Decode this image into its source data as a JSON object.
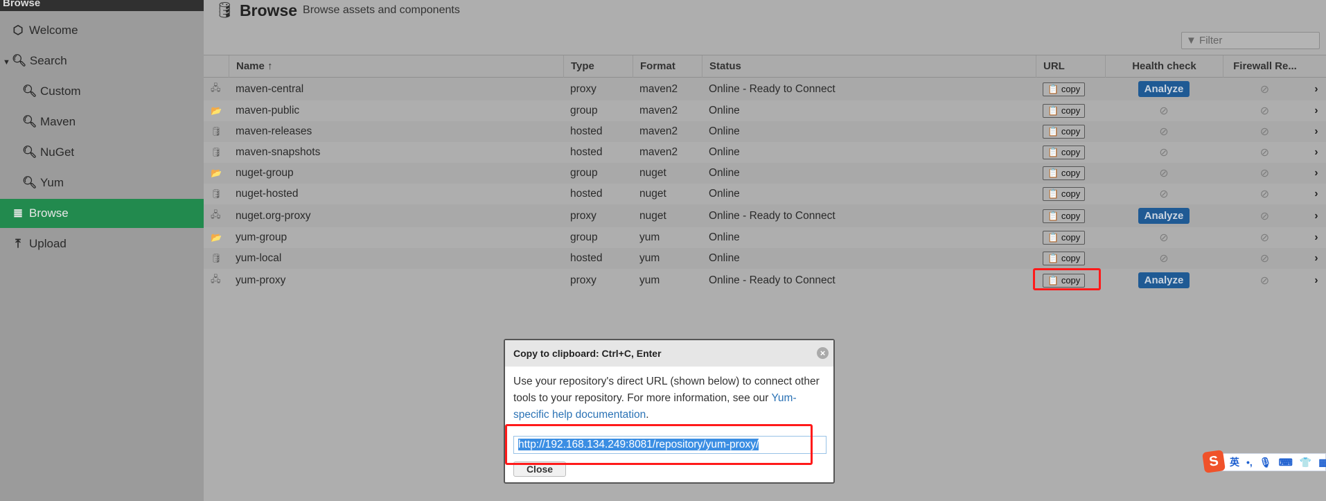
{
  "sidebar": {
    "header": "Browse",
    "items": [
      {
        "label": "Welcome",
        "icon": "hexagon-icon"
      },
      {
        "label": "Search",
        "icon": "search-icon",
        "expanded": true
      },
      {
        "label": "Custom",
        "icon": "search-icon"
      },
      {
        "label": "Maven",
        "icon": "search-icon"
      },
      {
        "label": "NuGet",
        "icon": "search-icon"
      },
      {
        "label": "Yum",
        "icon": "search-icon"
      },
      {
        "label": "Browse",
        "icon": "database-icon",
        "active": true
      },
      {
        "label": "Upload",
        "icon": "upload-icon"
      }
    ]
  },
  "header": {
    "title": "Browse",
    "subtitle": "Browse assets and components",
    "filter_placeholder": "Filter"
  },
  "table": {
    "columns": [
      "Name ↑",
      "Type",
      "Format",
      "Status",
      "URL",
      "Health check",
      "Firewall Re..."
    ],
    "copy_label": "copy",
    "analyze_label": "Analyze",
    "rows": [
      {
        "name": "maven-central",
        "type": "proxy",
        "format": "maven2",
        "status": "Online - Ready to Connect"
      },
      {
        "name": "maven-public",
        "type": "group",
        "format": "maven2",
        "status": "Online"
      },
      {
        "name": "maven-releases",
        "type": "hosted",
        "format": "maven2",
        "status": "Online"
      },
      {
        "name": "maven-snapshots",
        "type": "hosted",
        "format": "maven2",
        "status": "Online"
      },
      {
        "name": "nuget-group",
        "type": "group",
        "format": "nuget",
        "status": "Online"
      },
      {
        "name": "nuget-hosted",
        "type": "hosted",
        "format": "nuget",
        "status": "Online"
      },
      {
        "name": "nuget.org-proxy",
        "type": "proxy",
        "format": "nuget",
        "status": "Online - Ready to Connect"
      },
      {
        "name": "yum-group",
        "type": "group",
        "format": "yum",
        "status": "Online"
      },
      {
        "name": "yum-local",
        "type": "hosted",
        "format": "yum",
        "status": "Online"
      },
      {
        "name": "yum-proxy",
        "type": "proxy",
        "format": "yum",
        "status": "Online - Ready to Connect"
      }
    ]
  },
  "modal": {
    "title": "Copy to clipboard: Ctrl+C, Enter",
    "text": "Use your repository's direct URL (shown below) to connect other tools to your repository. For more information, see our ",
    "link": "Yum-specific help documentation",
    "text_end": ".",
    "url": "http://192.168.134.249:8081/repository/yum-proxy/",
    "close_label": "Close"
  },
  "ime": {
    "lang": "英",
    "punct": "•,"
  },
  "colors": {
    "active": "#228a4e",
    "analyze": "#1f5a94",
    "highlight": "#ff1a1a"
  }
}
